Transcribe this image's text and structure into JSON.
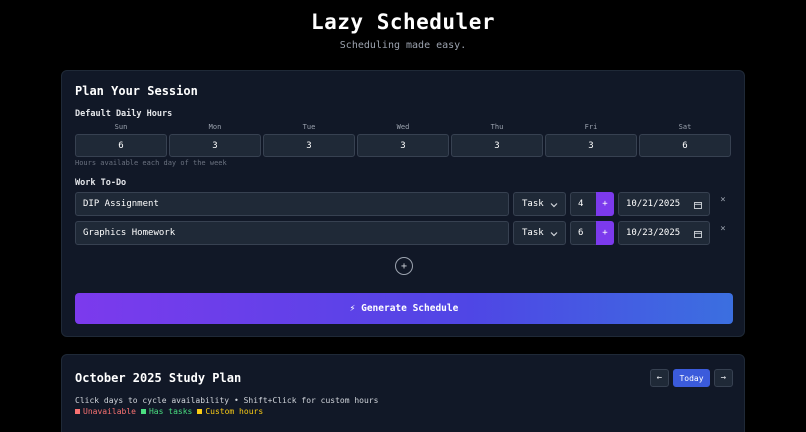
{
  "header": {
    "title": "Lazy Scheduler",
    "subtitle": "Scheduling made easy."
  },
  "plan": {
    "title": "Plan Your Session",
    "daily_hours_label": "Default Daily Hours",
    "days": [
      {
        "name": "Sun",
        "hours": "6"
      },
      {
        "name": "Mon",
        "hours": "3"
      },
      {
        "name": "Tue",
        "hours": "3"
      },
      {
        "name": "Wed",
        "hours": "3"
      },
      {
        "name": "Thu",
        "hours": "3"
      },
      {
        "name": "Fri",
        "hours": "3"
      },
      {
        "name": "Sat",
        "hours": "6"
      }
    ],
    "daily_hours_hint": "Hours available each day of the week",
    "todo_label": "Work To-Do",
    "tasks": [
      {
        "name": "DIP Assignment",
        "type": "Task",
        "hours": "4",
        "plus": "+",
        "date": "10/21/2025",
        "remove": "×"
      },
      {
        "name": "Graphics Homework",
        "type": "Task",
        "hours": "6",
        "plus": "+",
        "date": "10/23/2025",
        "remove": "×"
      }
    ],
    "add_task": "+",
    "generate_label": "⚡ Generate Schedule"
  },
  "calendar": {
    "title": "October 2025 Study Plan",
    "prev": "←",
    "today": "Today",
    "next": "→",
    "hint": "Click days to cycle availability • Shift+Click for custom hours",
    "legend": [
      {
        "label": "Unavailable",
        "color": "#f87171"
      },
      {
        "label": "Has tasks",
        "color": "#4ade80"
      },
      {
        "label": "Custom hours",
        "color": "#facc15"
      }
    ]
  },
  "icons": {
    "select": "chevron-down-icon",
    "date": "calendar-icon",
    "remove": "close-icon",
    "add": "plus-circle-icon",
    "generate": "lightning-icon"
  }
}
